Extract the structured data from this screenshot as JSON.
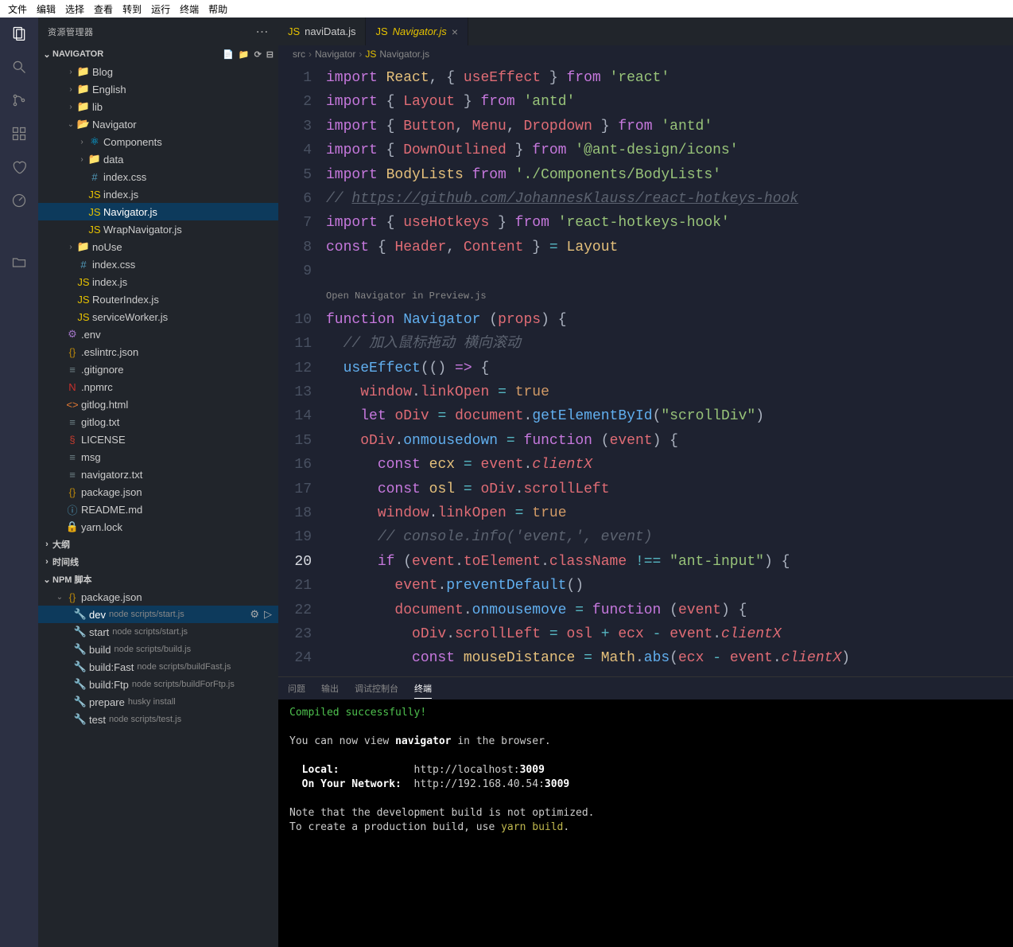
{
  "menubar": [
    "文件",
    "编辑",
    "选择",
    "查看",
    "转到",
    "运行",
    "终端",
    "帮助"
  ],
  "sidebar": {
    "title": "资源管理器",
    "project": "NAVIGATOR",
    "tree": [
      {
        "type": "folder",
        "name": "Blog",
        "depth": 1,
        "open": false
      },
      {
        "type": "folder",
        "name": "English",
        "depth": 1,
        "open": false
      },
      {
        "type": "folder",
        "name": "lib",
        "depth": 1,
        "open": false
      },
      {
        "type": "folder",
        "name": "Navigator",
        "depth": 1,
        "open": true
      },
      {
        "type": "folder",
        "name": "Components",
        "depth": 2,
        "open": false,
        "special": "react"
      },
      {
        "type": "folder",
        "name": "data",
        "depth": 2,
        "open": false
      },
      {
        "type": "file",
        "name": "index.css",
        "depth": 2,
        "icon": "css"
      },
      {
        "type": "file",
        "name": "index.js",
        "depth": 2,
        "icon": "js"
      },
      {
        "type": "file",
        "name": "Navigator.js",
        "depth": 2,
        "icon": "js",
        "selected": true
      },
      {
        "type": "file",
        "name": "WrapNavigator.js",
        "depth": 2,
        "icon": "js"
      },
      {
        "type": "folder",
        "name": "noUse",
        "depth": 1,
        "open": false
      },
      {
        "type": "file",
        "name": "index.css",
        "depth": 1,
        "icon": "css"
      },
      {
        "type": "file",
        "name": "index.js",
        "depth": 1,
        "icon": "js"
      },
      {
        "type": "file",
        "name": "RouterIndex.js",
        "depth": 1,
        "icon": "js"
      },
      {
        "type": "file",
        "name": "serviceWorker.js",
        "depth": 1,
        "icon": "js"
      },
      {
        "type": "file",
        "name": ".env",
        "depth": 0,
        "icon": "env"
      },
      {
        "type": "file",
        "name": ".eslintrc.json",
        "depth": 0,
        "icon": "json",
        "iconColor": "#c23b2e"
      },
      {
        "type": "file",
        "name": ".gitignore",
        "depth": 0,
        "icon": "txt"
      },
      {
        "type": "file",
        "name": ".npmrc",
        "depth": 0,
        "icon": "npm"
      },
      {
        "type": "file",
        "name": "gitlog.html",
        "depth": 0,
        "icon": "html"
      },
      {
        "type": "file",
        "name": "gitlog.txt",
        "depth": 0,
        "icon": "txt",
        "iconColor": "#6d8086"
      },
      {
        "type": "file",
        "name": "LICENSE",
        "depth": 0,
        "icon": "license"
      },
      {
        "type": "file",
        "name": "msg",
        "depth": 0,
        "icon": "txt"
      },
      {
        "type": "file",
        "name": "navigatorz.txt",
        "depth": 0,
        "icon": "txt"
      },
      {
        "type": "file",
        "name": "package.json",
        "depth": 0,
        "icon": "json"
      },
      {
        "type": "file",
        "name": "README.md",
        "depth": 0,
        "icon": "info"
      },
      {
        "type": "file",
        "name": "yarn.lock",
        "depth": 0,
        "icon": "lock"
      }
    ],
    "outline": "大纲",
    "timeline": "时间线",
    "npmScripts": {
      "title": "NPM 脚本",
      "package": "package.json",
      "scripts": [
        {
          "name": "dev",
          "cmd": "node scripts/start.js",
          "active": true
        },
        {
          "name": "start",
          "cmd": "node scripts/start.js"
        },
        {
          "name": "build",
          "cmd": "node scripts/build.js"
        },
        {
          "name": "build:Fast",
          "cmd": "node scripts/buildFast.js"
        },
        {
          "name": "build:Ftp",
          "cmd": "node scripts/buildForFtp.js"
        },
        {
          "name": "prepare",
          "cmd": "husky install"
        },
        {
          "name": "test",
          "cmd": "node scripts/test.js"
        }
      ]
    }
  },
  "tabs": [
    {
      "label": "naviData.js",
      "active": false
    },
    {
      "label": "Navigator.js",
      "active": true
    }
  ],
  "breadcrumbs": [
    "src",
    "Navigator",
    "Navigator.js"
  ],
  "codelens": "Open Navigator in Preview.js",
  "currentLine": 20,
  "panel": {
    "tabs": [
      "问题",
      "输出",
      "调试控制台",
      "终端"
    ],
    "activeTab": 3,
    "terminal": {
      "compiled": "Compiled successfully!",
      "view1": "You can now view ",
      "appName": "navigator",
      "view2": " in the browser.",
      "localLabel": "Local:",
      "localUrl": "http://localhost:",
      "port": "3009",
      "netLabel": "On Your Network:",
      "netUrl": "http://192.168.40.54:",
      "note1": "Note that the development build is not optimized.",
      "note2a": "To create a production build, use ",
      "note2b": "yarn build",
      "note2c": "."
    }
  }
}
